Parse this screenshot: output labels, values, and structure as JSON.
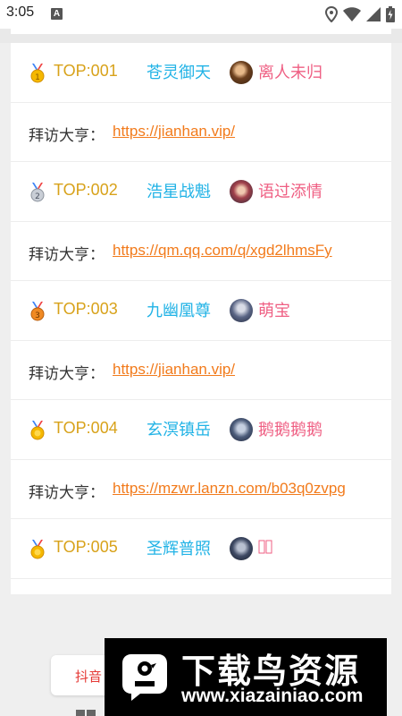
{
  "status_bar": {
    "time": "3:05",
    "notification_badge": "A",
    "icons": [
      "location-icon",
      "wifi-icon",
      "signal-icon",
      "battery-icon"
    ]
  },
  "rankings": [
    {
      "medal": "gold-medal-icon",
      "rank": "TOP:001",
      "guild": "苍灵御天",
      "player": "离人未归",
      "visit_label": "拜访大亨：",
      "visit_link": "https://jianhan.vip/"
    },
    {
      "medal": "silver-medal-icon",
      "rank": "TOP:002",
      "guild": "浩星战魁",
      "player": "语过添情",
      "visit_label": "拜访大亨：",
      "visit_link": "https://qm.qq.com/q/xgd2lhmsFy"
    },
    {
      "medal": "bronze-medal-icon",
      "rank": "TOP:003",
      "guild": "九幽凰尊",
      "player": "萌宝",
      "visit_label": "拜访大亨：",
      "visit_link": "https://jianhan.vip/"
    },
    {
      "medal": "gold-medal-icon",
      "rank": "TOP:004",
      "guild": "玄溟镇岳",
      "player": "鹅鹅鹅鹅",
      "visit_label": "拜访大亨：",
      "visit_link": "https://mzwr.lanzn.com/b03q0zvpg"
    },
    {
      "medal": "gold-medal-icon",
      "rank": "TOP:005",
      "guild": "圣辉普照",
      "player": "",
      "visit_label": "",
      "visit_link": ""
    }
  ],
  "bottom": {
    "douyin_button": "抖音"
  },
  "watermark": {
    "title": "下载鸟资源",
    "url": "www.xiazainiao.com"
  },
  "colors": {
    "rank_gold": "#d8a21a",
    "guild_blue": "#22b3e6",
    "player_pink": "#ef5f83",
    "link_orange": "#f27b1c",
    "douyin_red": "#e53935"
  }
}
